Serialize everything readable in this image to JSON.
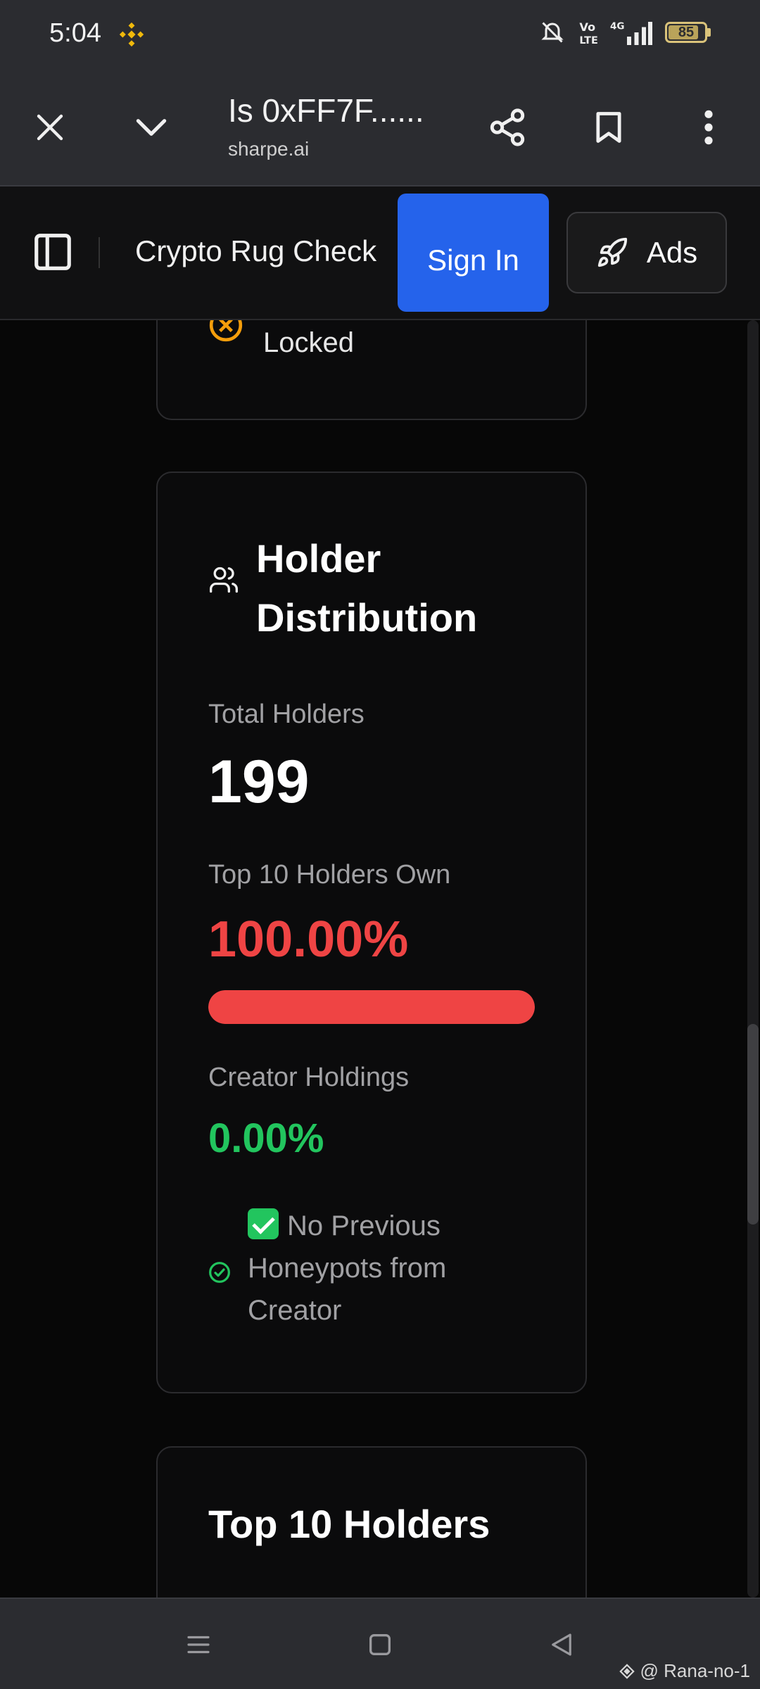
{
  "status_bar": {
    "time": "5:04",
    "battery": "85",
    "battery_level": 0.85,
    "icons": [
      "binance-icon",
      "mute-bell-icon",
      "volte-icon",
      "4g-icon",
      "signal-icon",
      "battery-icon"
    ]
  },
  "browser": {
    "title": "Is 0xFF7F......",
    "domain": "sharpe.ai",
    "icons": [
      "close-icon",
      "chevron-down-icon",
      "share-icon",
      "bookmark-icon",
      "more-vert-icon"
    ]
  },
  "site_header": {
    "title": "Crypto Rug Check",
    "sign_in": "Sign In",
    "ads": "Ads"
  },
  "prev_card": {
    "locked_text": "Locked"
  },
  "holder_card": {
    "title": "Holder Distribution",
    "total_holders_label": "Total Holders",
    "total_holders_value": "199",
    "top10_label": "Top 10 Holders Own",
    "top10_value": "100.00%",
    "top10_fraction": 1.0,
    "creator_label": "Creator Holdings",
    "creator_value": "0.00%",
    "honeypot_text": "No Previous Honeypots from Creator"
  },
  "top10_card": {
    "title": "Top 10 Holders"
  },
  "watermark": "@ Rana-no-1",
  "colors": {
    "red": "#ef4444",
    "green": "#22c55e",
    "blue": "#2563eb",
    "warn": "#f59e0b"
  }
}
